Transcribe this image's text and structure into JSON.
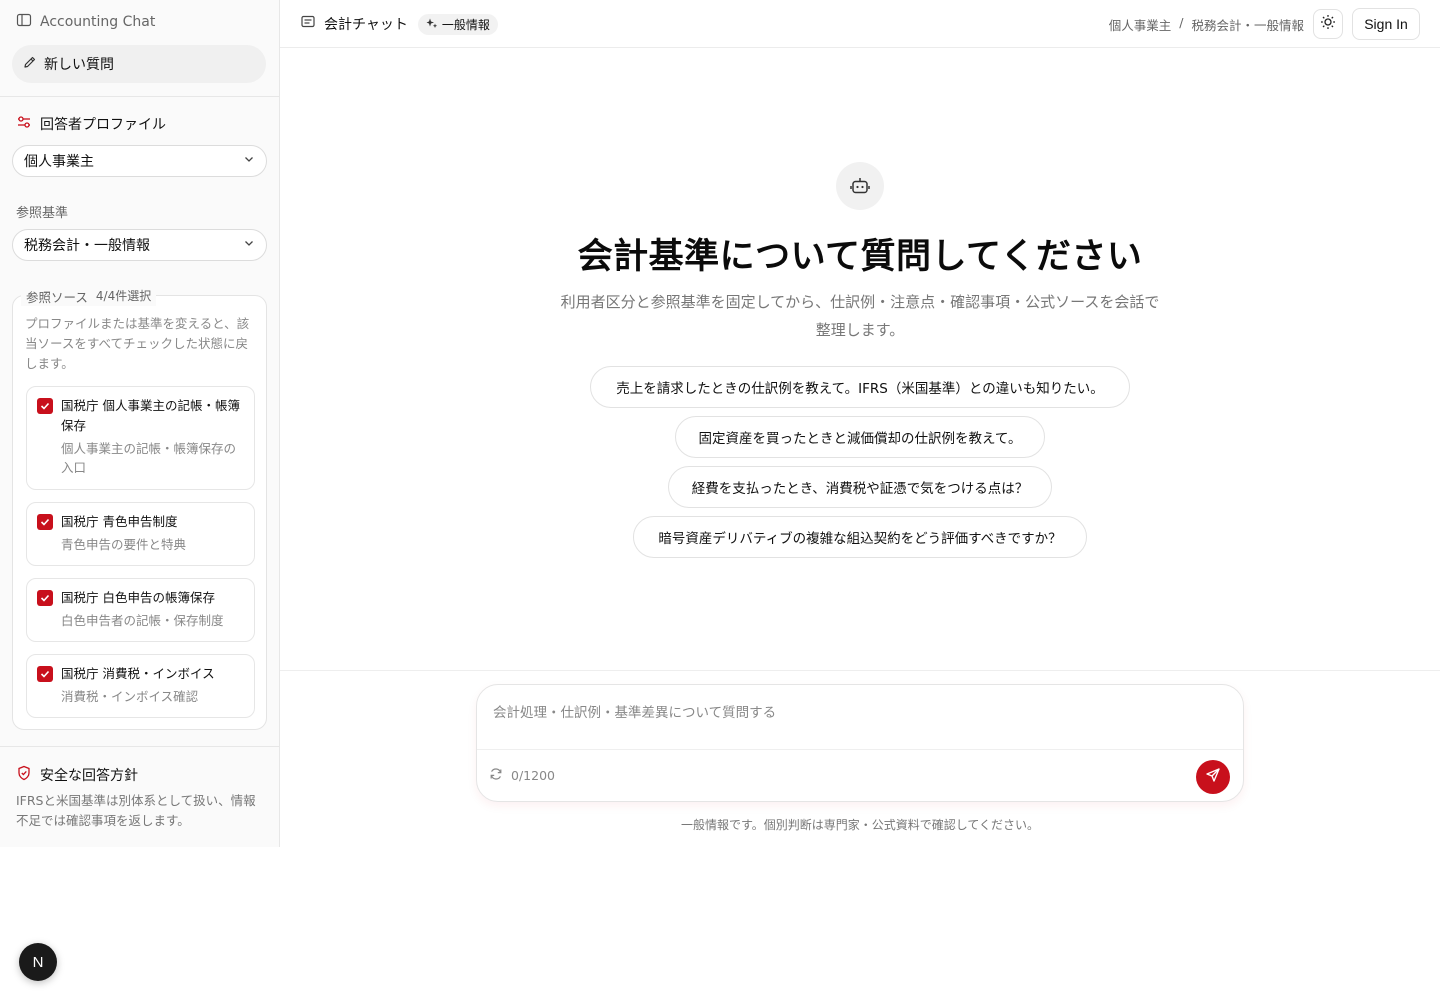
{
  "sidebar": {
    "app_title": "Accounting Chat",
    "new_question": "新しい質問",
    "profile_heading": "回答者プロファイル",
    "profile_value": "個人事業主",
    "standard_label": "参照基準",
    "standard_value": "税務会計・一般情報",
    "sources_label": "参照ソース",
    "sources_count": "4/4件選択",
    "sources_note": "プロファイルまたは基準を変えると、該当ソースをすべてチェックした状態に戻します。",
    "sources": [
      {
        "title": "国税庁 個人事業主の記帳・帳簿保存",
        "desc": "個人事業主の記帳・帳簿保存の入口",
        "checked": true
      },
      {
        "title": "国税庁 青色申告制度",
        "desc": "青色申告の要件と特典",
        "checked": true
      },
      {
        "title": "国税庁 白色申告の帳簿保存",
        "desc": "白色申告者の記帳・保存制度",
        "checked": true
      },
      {
        "title": "国税庁 消費税・インボイス",
        "desc": "消費税・インボイス確認",
        "checked": true
      }
    ],
    "policy_heading": "安全な回答方針",
    "policy_text": "IFRSと米国基準は別体系として扱い、情報不足では確認事項を返します。"
  },
  "header": {
    "title": "会計チャット",
    "badge": "一般情報",
    "breadcrumb": [
      "個人事業主",
      "/",
      "税務会計・一般情報"
    ],
    "sign_in": "Sign In"
  },
  "main": {
    "title": "会計基準について質問してください",
    "subtitle": "利用者区分と参照基準を固定してから、仕訳例・注意点・確認事項・公式ソースを会話で整理します。",
    "suggestions": [
      "売上を請求したときの仕訳例を教えて。IFRS（米国基準）との違いも知りたい。",
      "固定資産を買ったときと減価償却の仕訳例を教えて。",
      "経費を支払ったとき、消費税や証憑で気をつける点は？",
      "暗号資産デリバティブの複雑な組込契約をどう評価すべきですか？"
    ]
  },
  "composer": {
    "placeholder": "会計処理・仕訳例・基準差異について質問する",
    "value": "",
    "counter": "0/1200",
    "disclaimer": "一般情報です。個別判断は専門家・公式資料で確認してください。"
  },
  "floating": {
    "label": "N"
  },
  "colors": {
    "accent": "#c8101c"
  }
}
